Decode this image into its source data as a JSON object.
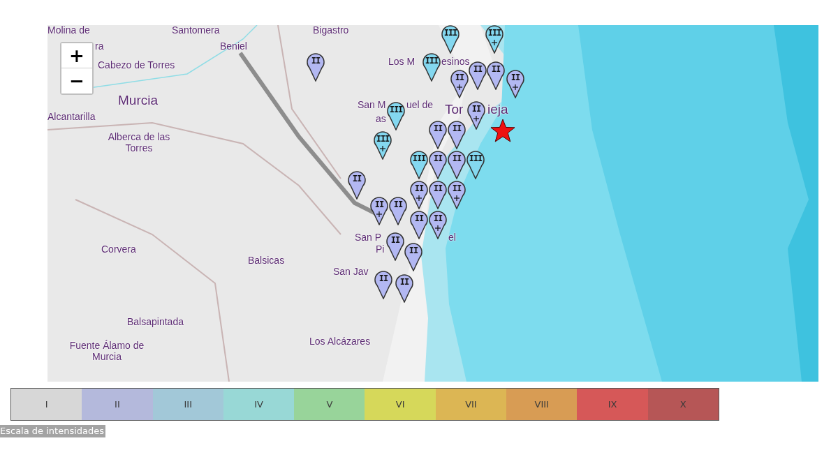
{
  "map": {
    "zoom_controls": [
      {
        "label": "+"
      },
      {
        "label": "−"
      }
    ],
    "labels": [
      {
        "text": "Molina de",
        "kind": "town"
      },
      {
        "text": "ra",
        "kind": "town"
      },
      {
        "text": "Santomera",
        "kind": "town"
      },
      {
        "text": "Bigastro",
        "kind": "town"
      },
      {
        "text": "Beniel",
        "kind": "town"
      },
      {
        "text": "Cabezo de Torres",
        "kind": "town"
      },
      {
        "text": "Murcia",
        "kind": "city"
      },
      {
        "text": "Alcantarilla",
        "kind": "town"
      },
      {
        "text": "Alberca de las Torres",
        "kind": "town"
      },
      {
        "text": "Los M",
        "kind": "town"
      },
      {
        "text": "esinos",
        "kind": "town"
      },
      {
        "text": "San M",
        "kind": "town"
      },
      {
        "text": "uel de",
        "kind": "town"
      },
      {
        "text": "as",
        "kind": "town"
      },
      {
        "text": "Tor",
        "kind": "city"
      },
      {
        "text": "ieja",
        "kind": "city"
      },
      {
        "text": "San P",
        "kind": "town"
      },
      {
        "text": "el",
        "kind": "town"
      },
      {
        "text": "Pi",
        "kind": "town"
      },
      {
        "text": "Corvera",
        "kind": "town"
      },
      {
        "text": "Balsicas",
        "kind": "town"
      },
      {
        "text": "San Jav",
        "kind": "town"
      },
      {
        "text": "Balsapintada",
        "kind": "town"
      },
      {
        "text": "Los Alcázares",
        "kind": "town"
      },
      {
        "text": "Fuente Álamo de Murcia",
        "kind": "town"
      }
    ],
    "pins": [
      {
        "intensity": "II",
        "plus": false,
        "color": "#b3b8f2"
      },
      {
        "intensity": "III",
        "plus": false,
        "color": "#84d8f0"
      },
      {
        "intensity": "III",
        "plus": false,
        "color": "#84d8f0"
      },
      {
        "intensity": "III",
        "plus": true,
        "color": "#84d8f0"
      },
      {
        "intensity": "II",
        "plus": true,
        "color": "#b3b8f2"
      },
      {
        "intensity": "II",
        "plus": false,
        "color": "#b3b8f2"
      },
      {
        "intensity": "II",
        "plus": false,
        "color": "#b3b8f2"
      },
      {
        "intensity": "II",
        "plus": true,
        "color": "#b3b8f2"
      },
      {
        "intensity": "II",
        "plus": true,
        "color": "#b3b8f2"
      },
      {
        "intensity": "III",
        "plus": false,
        "color": "#84d8f0"
      },
      {
        "intensity": "III",
        "plus": true,
        "color": "#84d8f0"
      },
      {
        "intensity": "II",
        "plus": false,
        "color": "#b3b8f2"
      },
      {
        "intensity": "II",
        "plus": true,
        "color": "#b3b8f2"
      },
      {
        "intensity": "II",
        "plus": false,
        "color": "#b3b8f2"
      },
      {
        "intensity": "II",
        "plus": true,
        "color": "#b3b8f2"
      },
      {
        "intensity": "II",
        "plus": false,
        "color": "#b3b8f2"
      },
      {
        "intensity": "II",
        "plus": true,
        "color": "#b3b8f2"
      },
      {
        "intensity": "II",
        "plus": false,
        "color": "#b3b8f2"
      },
      {
        "intensity": "II",
        "plus": false,
        "color": "#b3b8f2"
      },
      {
        "intensity": "II",
        "plus": false,
        "color": "#b3b8f2"
      },
      {
        "intensity": "II",
        "plus": false,
        "color": "#b3b8f2"
      },
      {
        "intensity": "II",
        "plus": false,
        "color": "#b3b8f2"
      },
      {
        "intensity": "II",
        "plus": false,
        "color": "#b3b8f2"
      },
      {
        "intensity": "III",
        "plus": false,
        "color": "#84d8f0"
      },
      {
        "intensity": "II",
        "plus": false,
        "color": "#b3b8f2"
      },
      {
        "intensity": "II",
        "plus": false,
        "color": "#b3b8f2"
      },
      {
        "intensity": "III",
        "plus": false,
        "color": "#84d8f0"
      },
      {
        "intensity": "II",
        "plus": false,
        "color": "#b3b8f2"
      },
      {
        "intensity": "II",
        "plus": true,
        "color": "#b3b8f2"
      }
    ]
  },
  "legend": {
    "items": [
      {
        "label": "I",
        "color": "#d7d7d7"
      },
      {
        "label": "II",
        "color": "#b4b9dc"
      },
      {
        "label": "III",
        "color": "#a2c8d8"
      },
      {
        "label": "IV",
        "color": "#98d8d6"
      },
      {
        "label": "V",
        "color": "#98d49a"
      },
      {
        "label": "VI",
        "color": "#d6d85a"
      },
      {
        "label": "VII",
        "color": "#dcb654"
      },
      {
        "label": "VIII",
        "color": "#d89c54"
      },
      {
        "label": "IX",
        "color": "#d65858"
      },
      {
        "label": "X",
        "color": "#b65656"
      }
    ],
    "caption": "Escala de intensidades"
  }
}
